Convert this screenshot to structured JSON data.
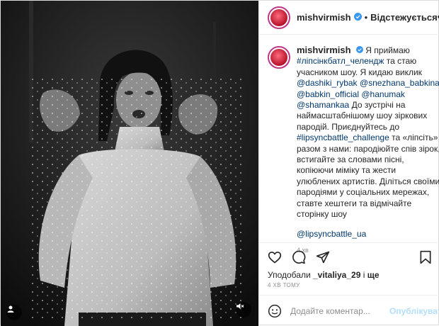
{
  "header": {
    "username": "mishvirmish",
    "separator": "•",
    "follow_label": "Відстежується",
    "more_label": "•••",
    "verified": true
  },
  "caption": {
    "username": "mishvirmish",
    "lines": [
      "Я приймаю",
      "#ліпсінкбатл_челендж та стаю",
      "учасником шоу. Я кидаю виклик",
      "@dashiki_rybak @snezhana_babkina",
      "@babkin_official @hanumak",
      "@shamankaa До зустрічі на",
      "наймасштабнішому шоу зіркових",
      "пародій. Приєднуйтесь до",
      "#lipsyncbattle_challenge та «ліпсіть»",
      "разом з нами: пародіюйте спів зірок,",
      "встигайте за словами пісні,",
      "копіюючи міміку та жести",
      "улюблених артистів. Діліться своїми",
      "пародіями у соціальних мережах,",
      "ставте хештеги та відмічайте",
      "сторінку шоу"
    ],
    "first_line_blue": "#ліпсінкбатл_челендж",
    "mentions_line4": [
      "@dashiki_rybak",
      "@snezhana_babkina"
    ],
    "line5_mentions": [
      "@babkin_official",
      "@hanumak"
    ],
    "line6_mention": "@shamankaa",
    "line6_rest": " До зустрічі на",
    "line9_tag": "#lipsyncbattle_challenge",
    "line9_rest": " та «ліпсіть»",
    "line2_rest": " та стаю",
    "line4_sep": " ",
    "line5_sep": " ",
    "final_mention": "@lipsyncbattle_ua",
    "time": "4 хв"
  },
  "actions": {
    "like_icon": "heart-icon",
    "comment_icon": "comment-icon",
    "share_icon": "share-icon",
    "save_icon": "bookmark-icon"
  },
  "likes": {
    "prefix": "Уподобали ",
    "user": "_vitaliya_29",
    "suffix": " і ",
    "more": "ще"
  },
  "timestamp": "4 хв тому",
  "comment_box": {
    "emoji_icon": "smiley-icon",
    "placeholder": "Додайте коментар...",
    "publish_label": "Опублікувати"
  },
  "media": {
    "tags_icon": "user-tags-icon",
    "mute_icon": "speaker-muted-icon"
  },
  "colors": {
    "accent_blue": "#00376b",
    "publish_disabled": "#b2dffc",
    "verified_blue": "#3897f0",
    "avatar_ring": "#c13584"
  }
}
